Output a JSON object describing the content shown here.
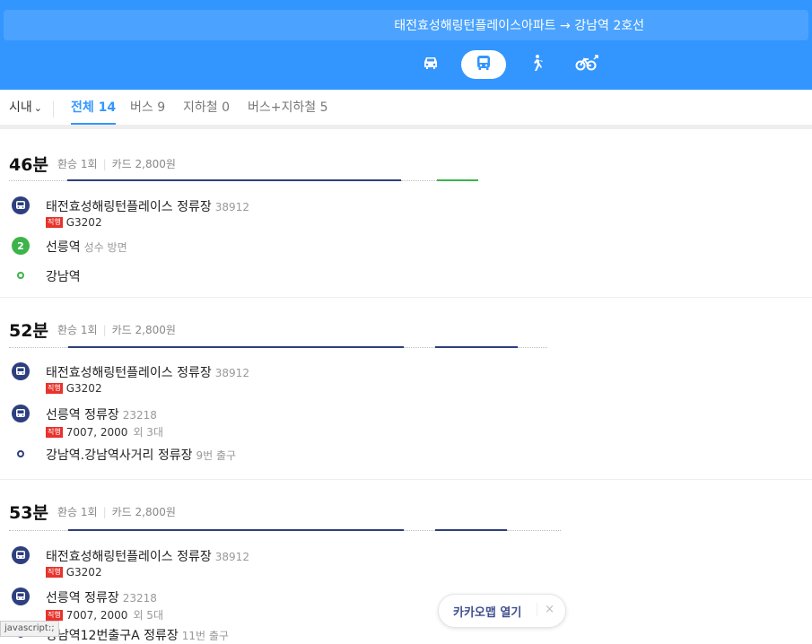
{
  "header": {
    "route_title": "태전효성해링턴플레이스아파트 → 강남역 2호선",
    "modes": [
      {
        "icon": "car-icon",
        "active": false
      },
      {
        "icon": "bus-icon",
        "active": true
      },
      {
        "icon": "walk-icon",
        "active": false
      },
      {
        "icon": "bike-icon",
        "active": false
      }
    ]
  },
  "tabs": {
    "city": "시내",
    "city_chevron": "⌄",
    "all": "전체 14",
    "bus": "버스 9",
    "subway": "지하철 0",
    "bus_subway": "버스+지하철 5"
  },
  "results": [
    {
      "duration": "46분",
      "transfer": "환승 1회",
      "fare": "카드 2,800원",
      "stops": [
        {
          "name": "태전효성해링턴플레이스 정류장",
          "id": "38912",
          "badge": "직행",
          "routes": "G3202"
        },
        {
          "name": "선릉역",
          "id": "성수 방면",
          "line_number": "2"
        },
        {
          "name": "강남역"
        }
      ]
    },
    {
      "duration": "52분",
      "transfer": "환승 1회",
      "fare": "카드 2,800원",
      "stops": [
        {
          "name": "태전효성해링턴플레이스 정류장",
          "id": "38912",
          "badge": "직행",
          "routes": "G3202"
        },
        {
          "name": "선릉역 정류장",
          "id": "23218",
          "badge": "직행",
          "routes": "7007, 2000",
          "extra": "외 3대"
        },
        {
          "name": "강남역.강남역사거리 정류장",
          "id": "9번 출구"
        }
      ]
    },
    {
      "duration": "53분",
      "transfer": "환승 1회",
      "fare": "카드 2,800원",
      "stops": [
        {
          "name": "태전효성해링턴플레이스 정류장",
          "id": "38912",
          "badge": "직행",
          "routes": "G3202"
        },
        {
          "name": "선릉역 정류장",
          "id": "23218",
          "badge": "직행",
          "routes": "7007, 2000",
          "extra": "외 5대"
        },
        {
          "name": "강남역12번출구A 정류장",
          "id": "11번 출구"
        }
      ]
    }
  ],
  "kakao_open": {
    "label": "카카오맵 열기",
    "close": "×"
  },
  "status_bar": "javascript:;",
  "colors": {
    "header_blue": "#3396ff",
    "bus_navy": "#2e3f7f",
    "subway_line2": "#3cb44b",
    "express_red": "#e8322b"
  }
}
